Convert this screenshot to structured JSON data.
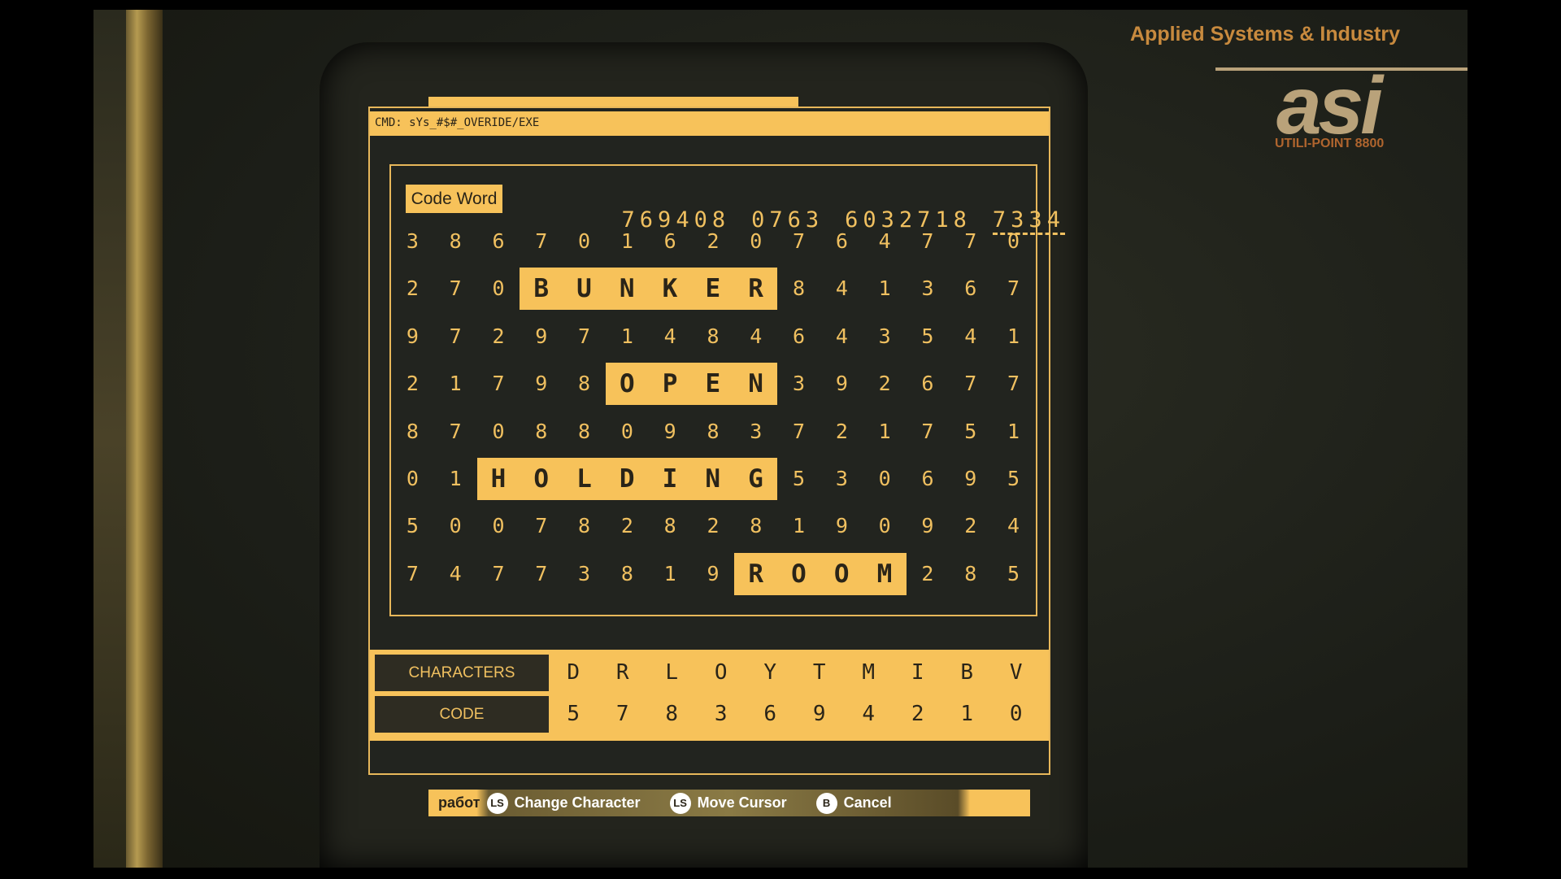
{
  "brand": {
    "company": "Applied Systems & Industry",
    "logo_text": "asi",
    "model": "UTILI-POINT 8800"
  },
  "terminal": {
    "cmd": "CMD: sYs_#$#_OVERIDE/EXE",
    "code_word_label": "Code Word",
    "code_word_groups": [
      "769408",
      "0763",
      "6032718",
      "7334"
    ],
    "grid": [
      {
        "digits": [
          "3",
          "8",
          "6",
          "7",
          "0",
          "1",
          "6",
          "2",
          "0",
          "7",
          "6",
          "4",
          "7",
          "7",
          "0"
        ]
      },
      {
        "digits": [
          "2",
          "7",
          "0",
          "B",
          "U",
          "N",
          "K",
          "E",
          "R",
          "8",
          "4",
          "1",
          "3",
          "6",
          "7"
        ],
        "word": "BUNKER",
        "start": 3,
        "end": 8
      },
      {
        "digits": [
          "9",
          "7",
          "2",
          "9",
          "7",
          "1",
          "4",
          "8",
          "4",
          "6",
          "4",
          "3",
          "5",
          "4",
          "1"
        ]
      },
      {
        "digits": [
          "2",
          "1",
          "7",
          "9",
          "8",
          "O",
          "P",
          "E",
          "N",
          "3",
          "9",
          "2",
          "6",
          "7",
          "7"
        ],
        "word": "OPEN",
        "start": 5,
        "end": 8
      },
      {
        "digits": [
          "8",
          "7",
          "0",
          "8",
          "8",
          "0",
          "9",
          "8",
          "3",
          "7",
          "2",
          "1",
          "7",
          "5",
          "1"
        ]
      },
      {
        "digits": [
          "0",
          "1",
          "H",
          "O",
          "L",
          "D",
          "I",
          "N",
          "G",
          "5",
          "3",
          "0",
          "6",
          "9",
          "5"
        ],
        "word": "HOLDING",
        "start": 2,
        "end": 8
      },
      {
        "digits": [
          "5",
          "0",
          "0",
          "7",
          "8",
          "2",
          "8",
          "2",
          "8",
          "1",
          "9",
          "0",
          "9",
          "2",
          "4"
        ]
      },
      {
        "digits": [
          "7",
          "4",
          "7",
          "7",
          "3",
          "8",
          "1",
          "9",
          "R",
          "O",
          "O",
          "M",
          "2",
          "8",
          "5"
        ],
        "word": "ROOM",
        "start": 8,
        "end": 11
      }
    ],
    "characters_label": "CHARACTERS",
    "characters": [
      "D",
      "R",
      "L",
      "O",
      "Y",
      "T",
      "M",
      "I",
      "B",
      "V"
    ],
    "code_label": "CODE",
    "codes": [
      "5",
      "7",
      "8",
      "3",
      "6",
      "9",
      "4",
      "2",
      "1",
      "0"
    ]
  },
  "legend": {
    "prefix": "работ",
    "items": [
      {
        "button": "LS",
        "icon": "left-stick-updown-icon",
        "label": "Change Character"
      },
      {
        "button": "LS",
        "icon": "left-stick-leftright-icon",
        "label": "Move Cursor"
      },
      {
        "button": "B",
        "icon": "b-button-icon",
        "label": "Cancel"
      }
    ]
  },
  "colors": {
    "accent": "#f7c25a",
    "text_dark": "#2a2418",
    "brand": "#c88a3e"
  }
}
